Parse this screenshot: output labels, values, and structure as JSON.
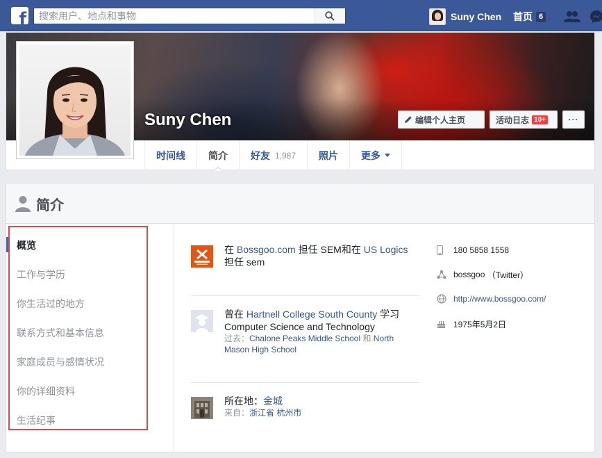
{
  "topbar": {
    "search_placeholder": "搜索用户、地点和事物",
    "user_name": "Suny Chen",
    "home_label": "首页",
    "home_count": "6"
  },
  "profile": {
    "name": "Suny Chen",
    "edit_button": "编辑个人主页",
    "activity_log_button": "活动日志",
    "activity_log_badge": "10+",
    "more_button": "···",
    "tabs": [
      {
        "label": "时间线"
      },
      {
        "label": "简介"
      },
      {
        "label": "好友",
        "count": "1,987"
      },
      {
        "label": "照片"
      },
      {
        "label": "更多"
      }
    ]
  },
  "about": {
    "title": "简介",
    "nav": [
      "概览",
      "工作与学历",
      "你生活过的地方",
      "联系方式和基本信息",
      "家庭成员与感情状况",
      "你的详细资料",
      "生活纪事"
    ],
    "work": {
      "p1": "在 ",
      "company1": "Bossgoo.com",
      "p2": " 担任 SEM和在 ",
      "company2": "US Logics",
      "p3": " 担任 sem"
    },
    "education": {
      "p1": "曾在 ",
      "school": "Hartnell College South County",
      "p2": " 学习 Computer Science and Technology",
      "past_label": "过去：",
      "past_school": "Chalone Peaks Middle School",
      "and": " 和 ",
      "past_school2": "North Mason High School"
    },
    "location": {
      "label": "所在地：",
      "city": "金城",
      "from_label": "来自：",
      "province": "浙江省",
      "from_city": "杭州市"
    },
    "contact": {
      "phone": "180 5858 1558",
      "twitter_name": "bossgoo",
      "twitter_label": "（Twitter）",
      "website": "http://www.bossgoo.com/",
      "birthday": "1975年5月2日"
    }
  },
  "colors": {
    "brand": "#3b5998",
    "link": "#365899",
    "highlight_box": "#e04a4a"
  }
}
